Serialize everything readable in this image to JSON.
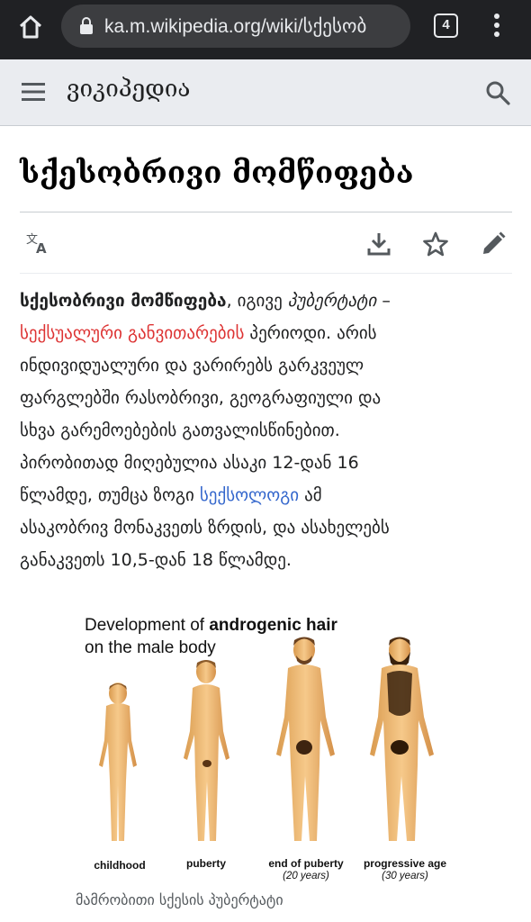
{
  "browser": {
    "url": "ka.m.wikipedia.org/wiki/სქესობ",
    "tab_count": "4"
  },
  "header": {
    "brand": "ვიკიპედია"
  },
  "article": {
    "title": "სქესობრივი მომწიფება",
    "lines": [
      [
        {
          "t": "სქესობრივი მომწიფება",
          "s": "bold"
        },
        {
          "t": ", იგივე "
        },
        {
          "t": "პუბერტატი",
          "s": "italic"
        },
        {
          "t": " –"
        }
      ],
      [
        {
          "t": "სექსუალური განვითარების",
          "s": "redlink"
        },
        {
          "t": " პერიოდი. არის"
        }
      ],
      [
        {
          "t": "ინდივიდუალური და ვარირებს გარკვეულ"
        }
      ],
      [
        {
          "t": "ფარგლებში რასობრივი, გეოგრაფიული და"
        }
      ],
      [
        {
          "t": "სხვა გარემოებების გათვალისწინებით."
        }
      ],
      [
        {
          "t": "პირობითად მიღებულია ასაკი 12-დან 16"
        }
      ],
      [
        {
          "t": "წლამდე, თუმცა ზოგი "
        },
        {
          "t": "სექსოლოგი",
          "s": "bluelink"
        },
        {
          "t": " ამ"
        }
      ],
      [
        {
          "t": "ასაკობრივ მონაკვეთს ზრდის, და ასახელებს"
        }
      ],
      [
        {
          "t": "განაკვეთს 10,5-დან 18 წლამდე."
        }
      ]
    ]
  },
  "figure": {
    "title_line1_prefix": "Development of ",
    "title_line1_bold": "androgenic hair",
    "title_line2": "on the male body",
    "stages": [
      {
        "label": "childhood",
        "sub": ""
      },
      {
        "label": "puberty",
        "sub": ""
      },
      {
        "label": "end of puberty",
        "sub": "(20 years)"
      },
      {
        "label": "progressive age",
        "sub": "(30 years)"
      }
    ],
    "caption": "მამრობითი სქესის პუბერტატი"
  },
  "colors": {
    "chrome_bg": "#202124",
    "header_bg": "#eaecf0",
    "redlink": "#dd3333",
    "bluelink": "#3366cc",
    "icon": "#54595d"
  },
  "icons": {
    "home": "home-icon",
    "lock": "lock-icon",
    "tabs": "tab-switcher-icon",
    "overflow": "more-vert-icon",
    "menu": "hamburger-menu-icon",
    "search": "search-icon",
    "language": "translate-icon",
    "download": "download-icon",
    "watch": "star-icon",
    "edit": "pencil-icon"
  }
}
